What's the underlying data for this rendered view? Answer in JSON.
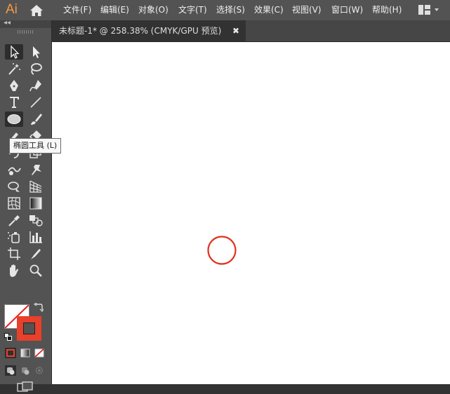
{
  "app": {
    "logo": "Ai",
    "logo_color": "#f29a4a"
  },
  "menu": [
    "文件(F)",
    "编辑(E)",
    "对象(O)",
    "文字(T)",
    "选择(S)",
    "效果(C)",
    "视图(V)",
    "窗口(W)",
    "帮助(H)"
  ],
  "document": {
    "tab_title": "未标题-1* @ 258.38% (CMYK/GPU 预览)",
    "close_glyph": "✖"
  },
  "toolbar": {
    "collapse_glyph": "◂◂",
    "tools": [
      {
        "name": "selection-tool-icon"
      },
      {
        "name": "direct-selection-tool-icon"
      },
      {
        "name": "magic-wand-tool-icon"
      },
      {
        "name": "lasso-tool-icon"
      },
      {
        "name": "pen-tool-icon"
      },
      {
        "name": "curvature-tool-icon"
      },
      {
        "name": "type-tool-icon"
      },
      {
        "name": "line-segment-tool-icon"
      },
      {
        "name": "ellipse-tool-icon",
        "selected": true
      },
      {
        "name": "paintbrush-tool-icon"
      },
      {
        "name": "shaper-tool-icon"
      },
      {
        "name": "eraser-tool-icon"
      },
      {
        "name": "rotate-tool-icon"
      },
      {
        "name": "scale-tool-icon"
      },
      {
        "name": "warp-tool-icon"
      },
      {
        "name": "puppet-warp-tool-icon"
      },
      {
        "name": "shape-builder-tool-icon"
      },
      {
        "name": "perspective-grid-tool-icon"
      },
      {
        "name": "mesh-tool-icon"
      },
      {
        "name": "gradient-tool-icon"
      },
      {
        "name": "eyedropper-tool-icon"
      },
      {
        "name": "blend-tool-icon"
      },
      {
        "name": "symbol-sprayer-tool-icon"
      },
      {
        "name": "column-graph-tool-icon"
      },
      {
        "name": "artboard-tool-icon"
      },
      {
        "name": "slice-tool-icon"
      },
      {
        "name": "hand-tool-icon"
      },
      {
        "name": "zoom-tool-icon"
      }
    ],
    "fill": "none",
    "stroke_color": "#e8402b"
  },
  "tooltip": {
    "text": "椭圆工具 (L)"
  },
  "canvas": {
    "shape": "ellipse",
    "stroke_color": "#e0311d",
    "background": "#ffffff"
  }
}
